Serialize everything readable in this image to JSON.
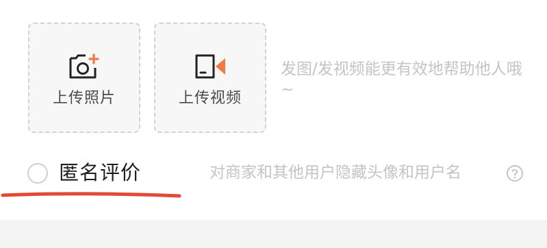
{
  "upload": {
    "photo_label": "上传照片",
    "video_label": "上传视频",
    "hint": "发图/发视频能更有效地帮助他人哦~",
    "photo_icon": "camera-plus-icon",
    "video_icon": "video-camera-icon"
  },
  "anonymous": {
    "label": "匿名评价",
    "checked": false,
    "hint": "对商家和其他用户隐藏头像和用户名",
    "help_icon": "question-circle-icon"
  },
  "colors": {
    "accent": "#f07a45",
    "annotation_red": "#e24a35",
    "hint_text": "#c4c4c4",
    "tile_border": "#d2d2d2"
  }
}
